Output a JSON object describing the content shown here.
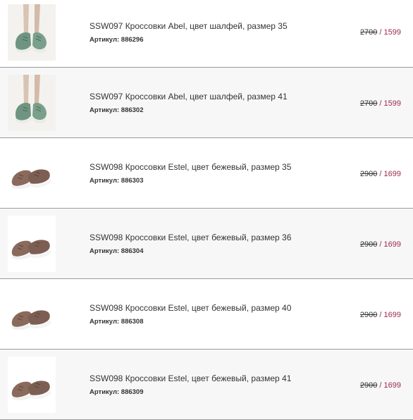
{
  "items": [
    {
      "title": "SSW097 Кроссовки Abel, цвет шалфей, размер 35",
      "sku_label": "Артикул:",
      "sku": "886296",
      "old_price": "2700",
      "sep": "/",
      "new_price": "1599",
      "image": "green-sneaker-on-foot"
    },
    {
      "title": "SSW097 Кроссовки Abel, цвет шалфей, размер 41",
      "sku_label": "Артикул:",
      "sku": "886302",
      "old_price": "2700",
      "sep": "/",
      "new_price": "1599",
      "image": "green-sneaker-on-foot"
    },
    {
      "title": "SSW098 Кроссовки Estel, цвет бежевый, размер 35",
      "sku_label": "Артикул:",
      "sku": "886303",
      "old_price": "2900",
      "sep": "/",
      "new_price": "1699",
      "image": "brown-sneakers-pair"
    },
    {
      "title": "SSW098 Кроссовки Estel, цвет бежевый, размер 36",
      "sku_label": "Артикул:",
      "sku": "886304",
      "old_price": "2900",
      "sep": "/",
      "new_price": "1699",
      "image": "brown-sneakers-pair"
    },
    {
      "title": "SSW098 Кроссовки Estel, цвет бежевый, размер 40",
      "sku_label": "Артикул:",
      "sku": "886308",
      "old_price": "2900",
      "sep": "/",
      "new_price": "1699",
      "image": "brown-sneakers-pair"
    },
    {
      "title": "SSW098 Кроссовки Estel, цвет бежевый, размер 41",
      "sku_label": "Артикул:",
      "sku": "886309",
      "old_price": "2900",
      "sep": "/",
      "new_price": "1699",
      "image": "brown-sneakers-pair"
    }
  ],
  "colors": {
    "accent": "#9c2a4a",
    "text": "#333333",
    "divider": "#9a9a9a",
    "alt_row": "#f7f7f7"
  }
}
